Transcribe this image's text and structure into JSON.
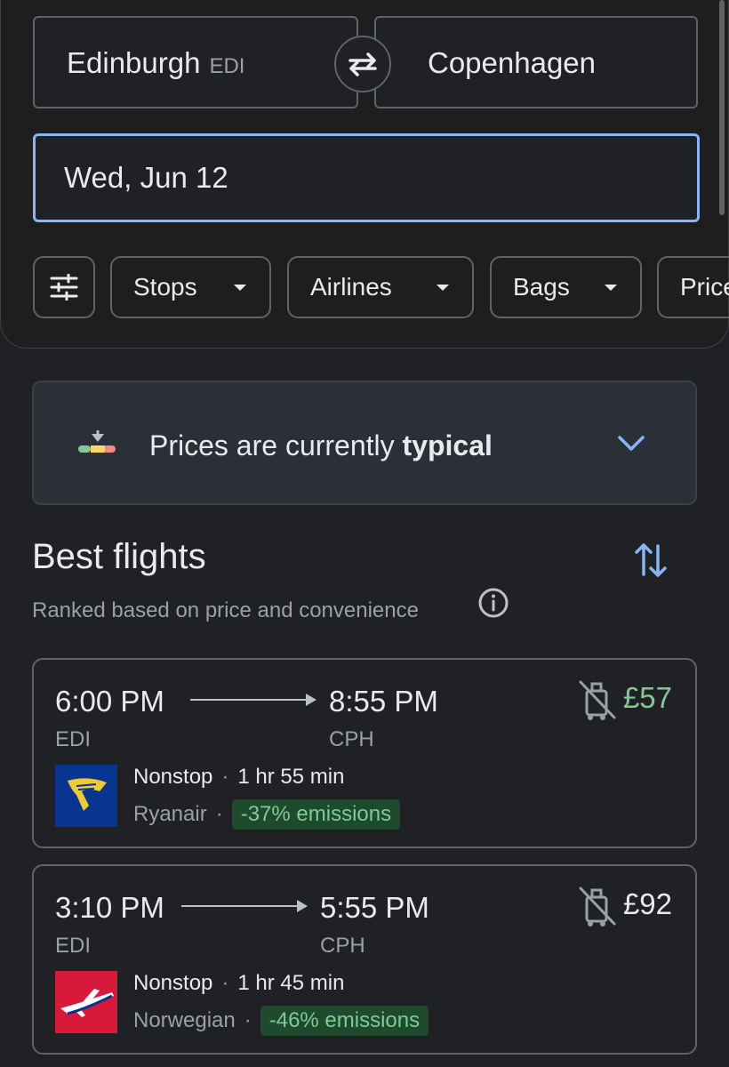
{
  "search": {
    "origin_city": "Edinburgh",
    "origin_code": "EDI",
    "destination_city": "Copenhagen",
    "date": "Wed, Jun 12"
  },
  "filters": {
    "chips": [
      "Stops",
      "Airlines",
      "Bags",
      "Price"
    ]
  },
  "insight": {
    "text_prefix": "Prices are currently ",
    "text_emphasis": "typical"
  },
  "section": {
    "title": "Best flights",
    "subtitle": "Ranked based on price and convenience"
  },
  "flights": [
    {
      "depart_time": "6:00 PM",
      "arrive_time": "8:55 PM",
      "depart_airport": "EDI",
      "arrive_airport": "CPH",
      "price": "£57",
      "stops": "Nonstop",
      "duration": "1 hr 55 min",
      "airline": "Ryanair",
      "emissions": "-37% emissions"
    },
    {
      "depart_time": "3:10 PM",
      "arrive_time": "5:55 PM",
      "depart_airport": "EDI",
      "arrive_airport": "CPH",
      "price": "£92",
      "stops": "Nonstop",
      "duration": "1 hr 45 min",
      "airline": "Norwegian",
      "emissions": "-46% emissions"
    }
  ],
  "colors": {
    "accent": "#8ab4f8",
    "price_low": "#81c995",
    "price_normal": "#e8eaed",
    "emissions_bg": "#1e4a2e",
    "ryanair_blue": "#073590",
    "ryanair_yellow": "#f1c933",
    "norwegian_red": "#d81939"
  },
  "icons": {
    "swap": "swap-arrows-icon",
    "filters": "tune-icon",
    "dropdown": "caret-down-icon",
    "insight": "price-gauge-icon",
    "expand": "chevron-down-icon",
    "info": "info-icon",
    "sort": "sort-arrows-icon",
    "bags": "no-carry-on-bag-icon"
  }
}
